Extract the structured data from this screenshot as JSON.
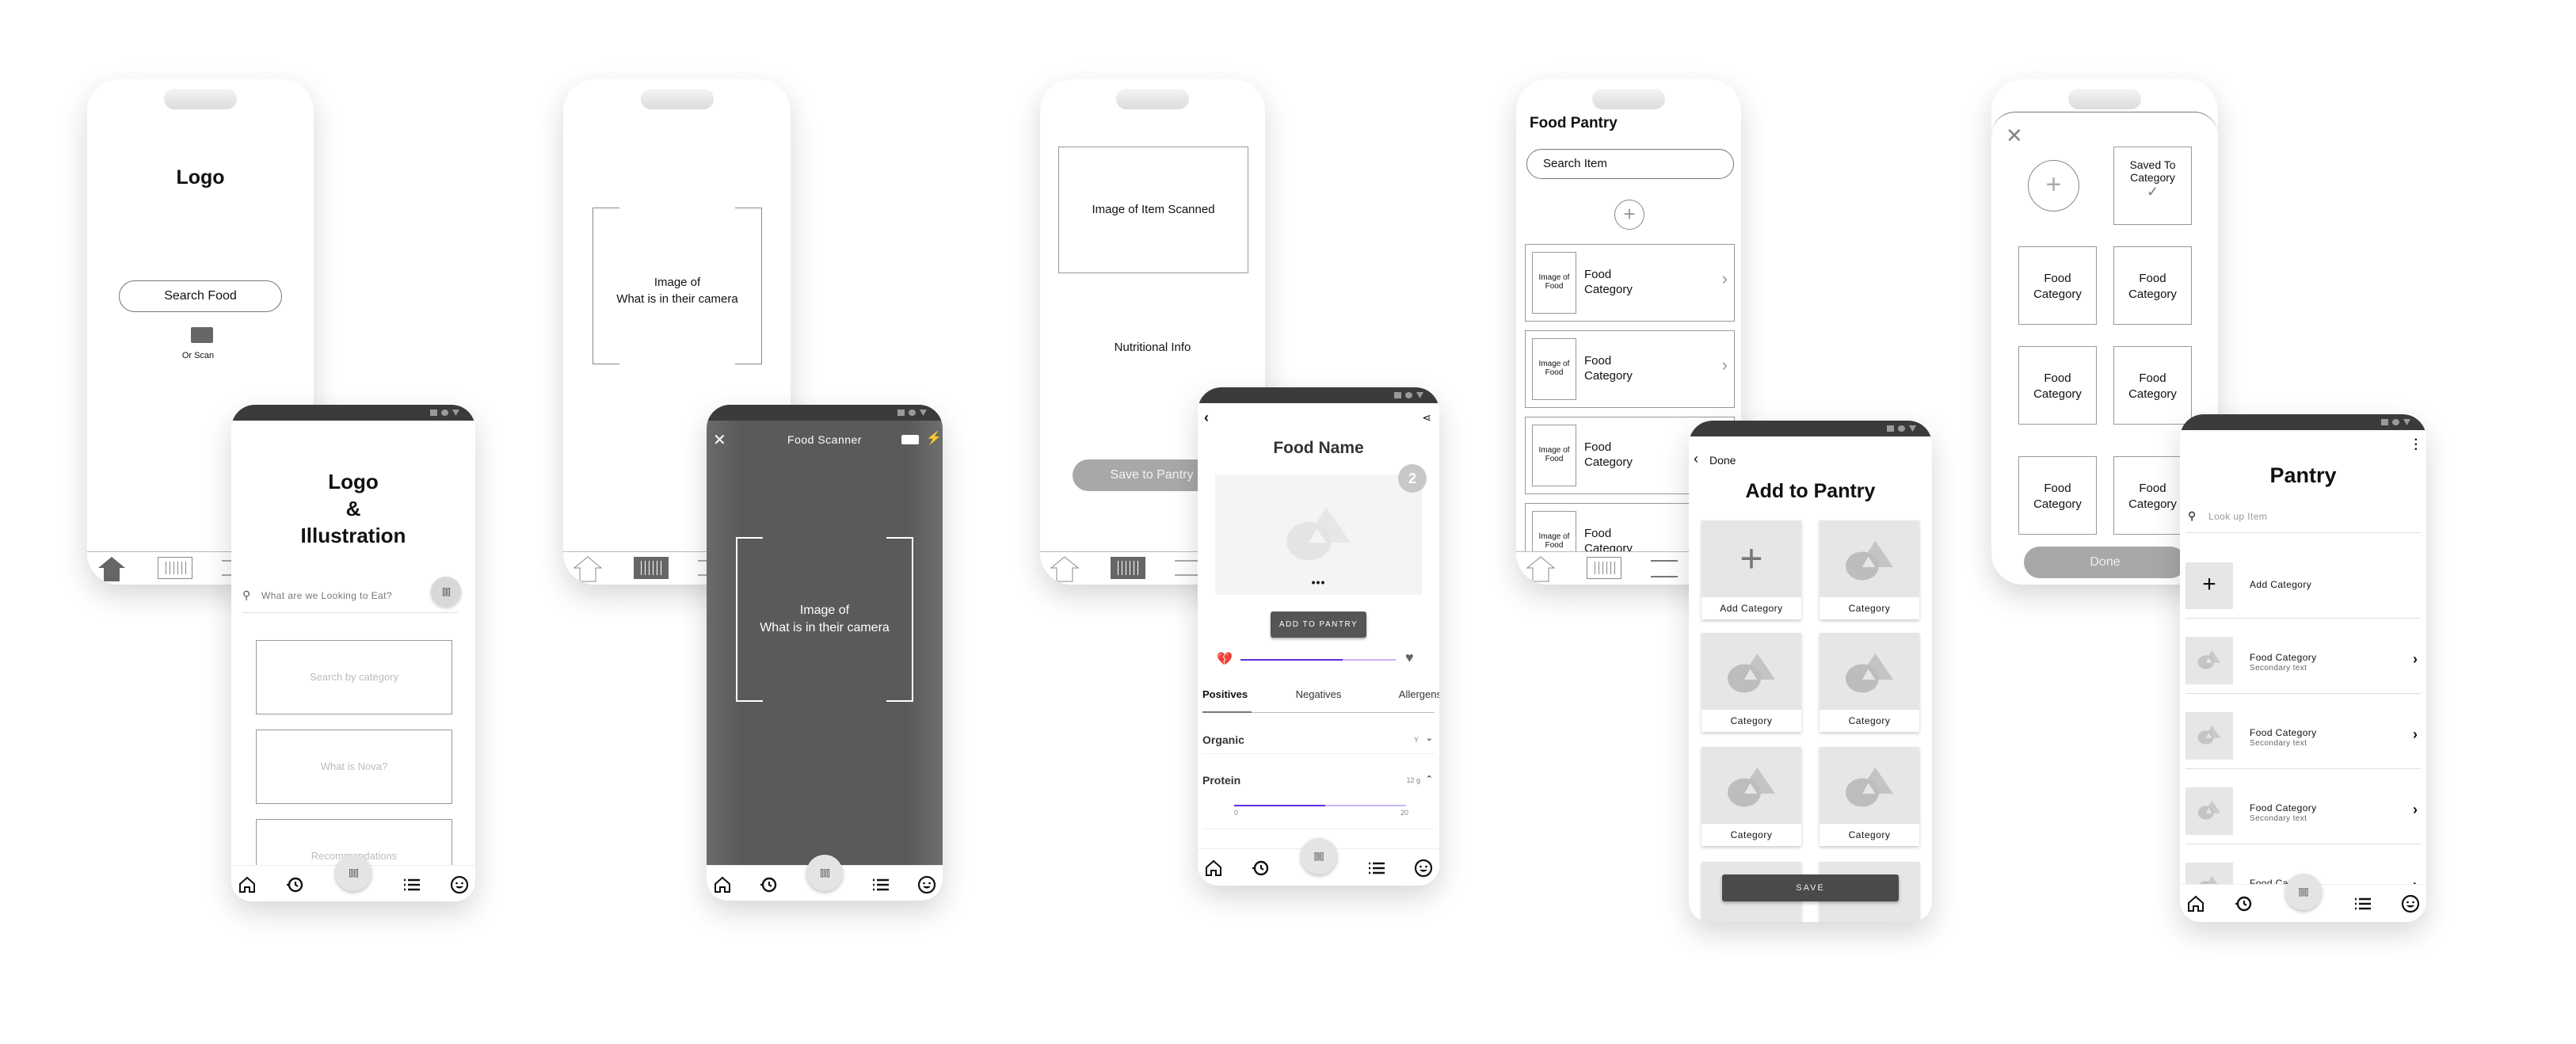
{
  "screens": {
    "home_ios": {
      "logo": "Logo",
      "search_button": "Search Food",
      "scan_label": "Or Scan"
    },
    "home_android": {
      "title_lines": [
        "Logo",
        "&",
        "Illustration"
      ],
      "search_placeholder": "What are we Looking to Eat?",
      "cards": [
        "Search by category",
        "What is Nova?",
        "Recommendations"
      ]
    },
    "scan_ios": {
      "camera_text": [
        "Image of",
        "What is in their camera"
      ]
    },
    "scan_android": {
      "title": "Food Scanner",
      "camera_text": [
        "Image of",
        "What is in their camera"
      ]
    },
    "result_ios": {
      "image_label": "Image of Item Scanned",
      "nutrition_label": "Nutritional Info",
      "save_button": "Save to Pantry"
    },
    "result_android": {
      "title": "Food Name",
      "badge": "2",
      "add_button": "ADD TO PANTRY",
      "rating_fraction": 0.66,
      "tabs": [
        "Positives",
        "Negatives",
        "Allergens"
      ],
      "active_tab": "Positives",
      "organic": {
        "label": "Organic",
        "value": "Y"
      },
      "protein": {
        "label": "Protein",
        "value": "12 g",
        "min": "0",
        "max": "20",
        "amount": 12
      },
      "accent_color": "#5b2ee0"
    },
    "pantry_ios": {
      "title": "Food Pantry",
      "search_placeholder": "Search Item",
      "items": [
        {
          "image": "Image of Food",
          "label": "Food Category"
        },
        {
          "image": "Image of Food",
          "label": "Food Category"
        },
        {
          "image": "Image of Food",
          "label": "Food Category"
        },
        {
          "image": "Image of Food",
          "label": "Food Category"
        }
      ]
    },
    "add_android": {
      "back_label": "Done",
      "title": "Add to Pantry",
      "tiles": [
        "Add Category",
        "Category",
        "Category",
        "Category",
        "Category",
        "Category"
      ],
      "save_button": "SAVE"
    },
    "category_ios": {
      "saved_label": "Saved To Category",
      "categories": [
        "Food Category",
        "Food Category",
        "Food Category",
        "Food Category",
        "Food Category",
        "Food Category"
      ],
      "done_button": "Done"
    },
    "pantry_android": {
      "title": "Pantry",
      "search_placeholder": "Look up Item",
      "add_label": "Add Category",
      "items": [
        {
          "title": "Food Category",
          "subtitle": "Secondary text"
        },
        {
          "title": "Food Category",
          "subtitle": "Secondary text"
        },
        {
          "title": "Food Category",
          "subtitle": "Secondary text"
        },
        {
          "title": "Food Category"
        }
      ]
    }
  }
}
